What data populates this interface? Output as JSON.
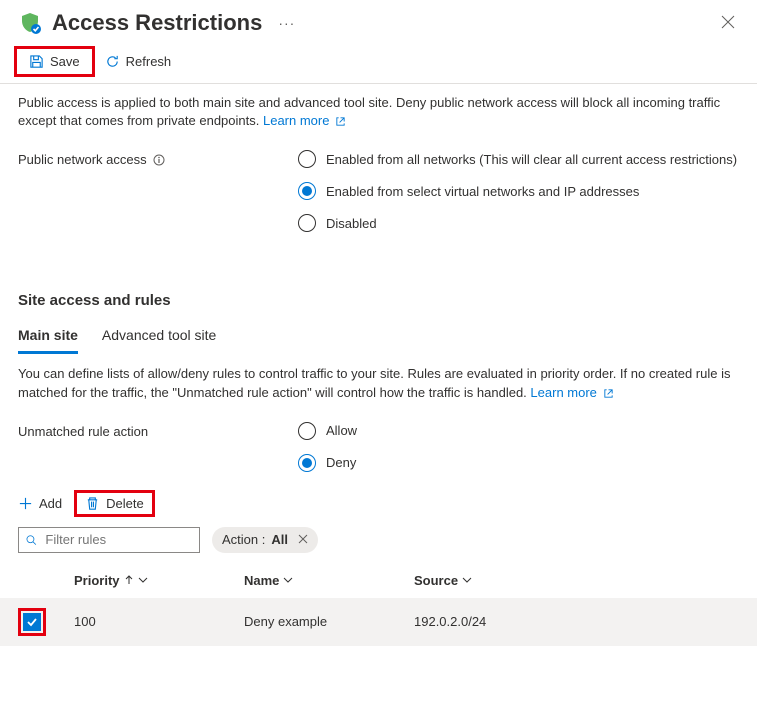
{
  "header": {
    "title": "Access Restrictions",
    "ellipsis": "···"
  },
  "toolbar": {
    "save_label": "Save",
    "refresh_label": "Refresh"
  },
  "intro": {
    "text": "Public access is applied to both main site and advanced tool site. Deny public network access will block all incoming traffic except that comes from private endpoints.",
    "learn_more": "Learn more"
  },
  "public_access": {
    "label": "Public network access",
    "options": {
      "all": "Enabled from all networks (This will clear all current access restrictions)",
      "select": "Enabled from select virtual networks and IP addresses",
      "disabled": "Disabled"
    }
  },
  "site_rules": {
    "heading": "Site access and rules",
    "tabs": {
      "main": "Main site",
      "advanced": "Advanced tool site"
    },
    "help_text": "You can define lists of allow/deny rules to control traffic to your site. Rules are evaluated in priority order. If no created rule is matched for the traffic, the \"Unmatched rule action\" will control how the traffic is handled.",
    "learn_more": "Learn more"
  },
  "unmatched": {
    "label": "Unmatched rule action",
    "allow": "Allow",
    "deny": "Deny"
  },
  "table": {
    "add": "Add",
    "delete": "Delete",
    "filter_placeholder": "Filter rules",
    "action_label": "Action :",
    "action_value": "All",
    "columns": {
      "priority": "Priority",
      "name": "Name",
      "source": "Source"
    },
    "rows": [
      {
        "priority": "100",
        "name": "Deny example",
        "source": "192.0.2.0/24",
        "checked": true
      }
    ]
  }
}
